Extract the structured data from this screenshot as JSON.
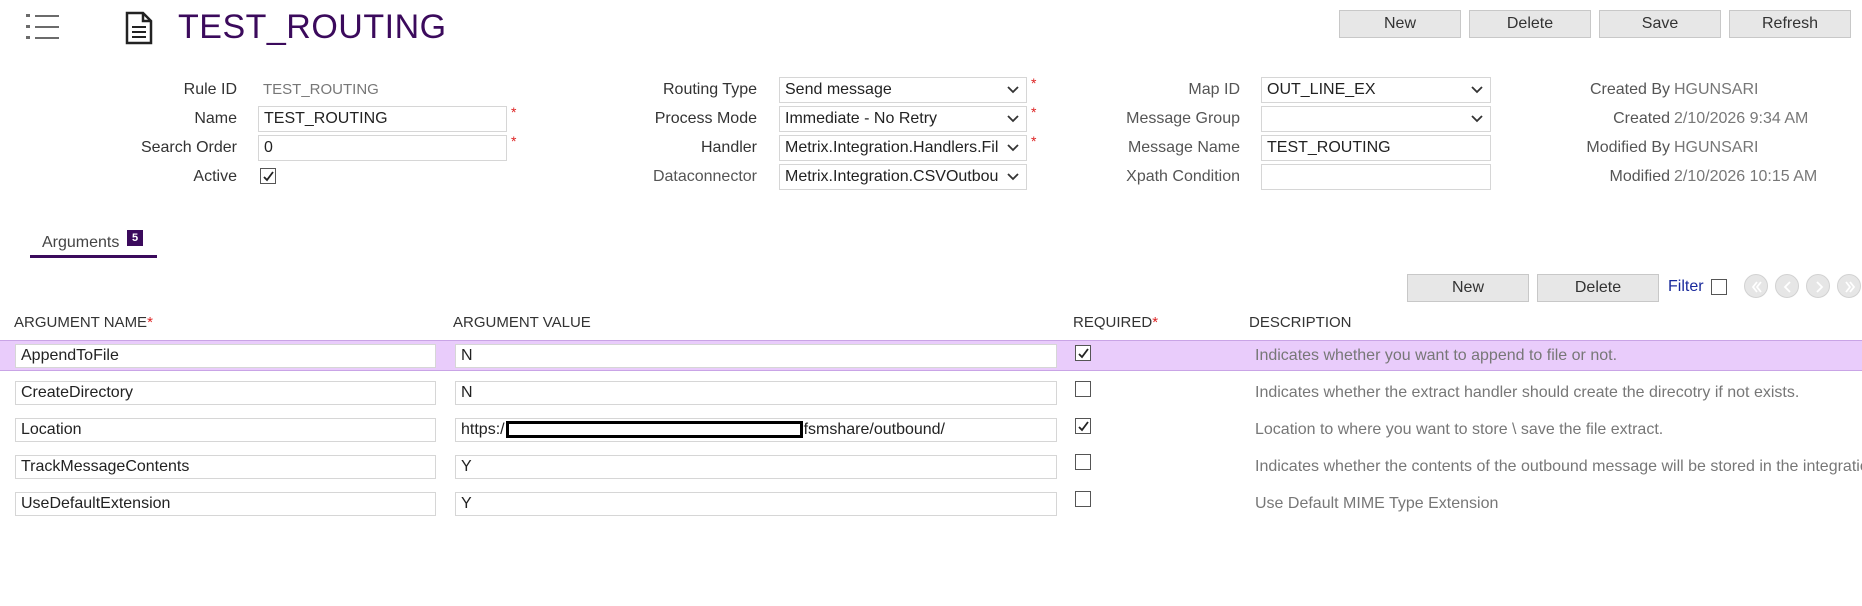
{
  "header": {
    "title": "TEST_ROUTING",
    "buttons": {
      "new": "New",
      "delete": "Delete",
      "save": "Save",
      "refresh": "Refresh"
    }
  },
  "form": {
    "rule_id": {
      "label": "Rule ID",
      "value": "TEST_ROUTING"
    },
    "name": {
      "label": "Name",
      "value": "TEST_ROUTING"
    },
    "search_order": {
      "label": "Search Order",
      "value": "0"
    },
    "active": {
      "label": "Active",
      "checked": true
    },
    "routing_type": {
      "label": "Routing Type",
      "value": "Send message"
    },
    "process_mode": {
      "label": "Process Mode",
      "value": "Immediate - No Retry"
    },
    "handler": {
      "label": "Handler",
      "value": "Metrix.Integration.Handlers.Fil"
    },
    "dataconnector": {
      "label": "Dataconnector",
      "value": "Metrix.Integration.CSVOutbou"
    },
    "map_id": {
      "label": "Map ID",
      "value": "OUT_LINE_EX"
    },
    "message_group": {
      "label": "Message Group",
      "value": ""
    },
    "message_name": {
      "label": "Message Name",
      "value": "TEST_ROUTING"
    },
    "xpath_condition": {
      "label": "Xpath Condition",
      "value": ""
    },
    "created_by": {
      "label": "Created By",
      "value": "HGUNSARI"
    },
    "created": {
      "label": "Created",
      "value": "2/10/2026 9:34 AM"
    },
    "modified_by": {
      "label": "Modified By",
      "value": "HGUNSARI"
    },
    "modified": {
      "label": "Modified",
      "value": "2/10/2026 10:15 AM"
    },
    "required_marker": "*"
  },
  "tabs": [
    {
      "label": "Arguments",
      "badge": "5",
      "active": true
    }
  ],
  "grid": {
    "buttons": {
      "new": "New",
      "delete": "Delete"
    },
    "filter_label": "Filter",
    "columns": {
      "argument_name": "ARGUMENT NAME",
      "argument_value": "ARGUMENT VALUE",
      "required": "REQUIRED",
      "description": "DESCRIPTION"
    },
    "rows": [
      {
        "name": "AppendToFile",
        "value": "N",
        "required": true,
        "description": "Indicates whether you want to append to file or not."
      },
      {
        "name": "CreateDirectory",
        "value": "N",
        "required": false,
        "description": "Indicates whether the extract handler should create the direcotry if not exists."
      },
      {
        "name": "Location",
        "value_prefix": "https:/",
        "value_suffix": "fsmshare/outbound/",
        "required": true,
        "description": "Location to where you want to store \\ save the file extract."
      },
      {
        "name": "TrackMessageContents",
        "value": "Y",
        "required": false,
        "description": "Indicates whether the contents of the outbound message will be stored in the integration"
      },
      {
        "name": "UseDefaultExtension",
        "value": "Y",
        "required": false,
        "description": "Use Default MIME Type Extension"
      }
    ]
  },
  "colors": {
    "title": "#3b0a5c",
    "tab_underline": "#3b0a5c",
    "selected_row": "#e9ccfb",
    "required_star": "#dd2222"
  }
}
